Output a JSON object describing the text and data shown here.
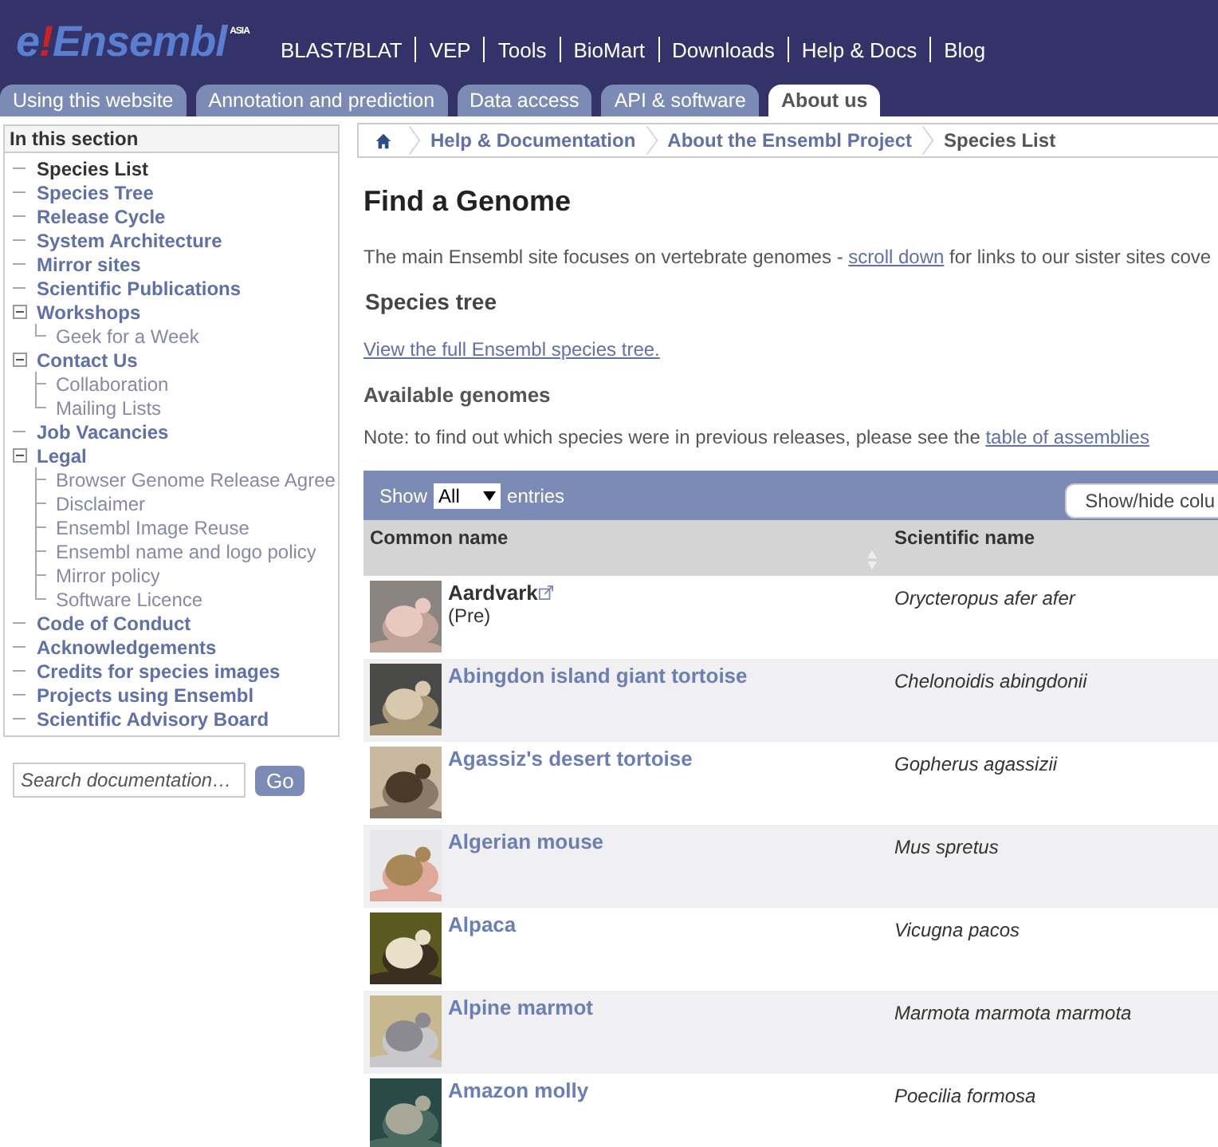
{
  "logo": {
    "parts": [
      "e",
      "!",
      "Ensembl"
    ],
    "badge": "ASIA"
  },
  "top_nav": [
    "BLAST/BLAT",
    "VEP",
    "Tools",
    "BioMart",
    "Downloads",
    "Help & Docs",
    "Blog"
  ],
  "tabs": [
    {
      "label": "Using this website",
      "selected": false
    },
    {
      "label": "Annotation and prediction",
      "selected": false
    },
    {
      "label": "Data access",
      "selected": false
    },
    {
      "label": "API & software",
      "selected": false
    },
    {
      "label": "About us",
      "selected": true
    }
  ],
  "sidebar": {
    "title": "In this section",
    "items": [
      {
        "label": "Species List",
        "selected": true
      },
      {
        "label": "Species Tree",
        "selected": false
      },
      {
        "label": "Release Cycle",
        "selected": false
      },
      {
        "label": "System Architecture",
        "selected": false
      },
      {
        "label": "Mirror sites",
        "selected": false
      },
      {
        "label": "Scientific Publications",
        "selected": false
      },
      {
        "label": "Workshops",
        "selected": false,
        "expanded": true,
        "children": [
          {
            "label": "Geek for a Week"
          }
        ]
      },
      {
        "label": "Contact Us",
        "selected": false,
        "expanded": true,
        "children": [
          {
            "label": "Collaboration"
          },
          {
            "label": "Mailing Lists"
          }
        ]
      },
      {
        "label": "Job Vacancies",
        "selected": false
      },
      {
        "label": "Legal",
        "selected": false,
        "expanded": true,
        "children": [
          {
            "label": "Browser Genome Release Agree"
          },
          {
            "label": "Disclaimer"
          },
          {
            "label": "Ensembl Image Reuse"
          },
          {
            "label": "Ensembl name and logo policy"
          },
          {
            "label": "Mirror policy"
          },
          {
            "label": "Software Licence"
          }
        ]
      },
      {
        "label": "Code of Conduct",
        "selected": false
      },
      {
        "label": "Acknowledgements",
        "selected": false
      },
      {
        "label": "Credits for species images",
        "selected": false
      },
      {
        "label": "Projects using Ensembl",
        "selected": false
      },
      {
        "label": "Scientific Advisory Board",
        "selected": false
      }
    ]
  },
  "search": {
    "placeholder": "Search documentation…",
    "button": "Go"
  },
  "breadcrumb": [
    "Help & Documentation",
    "About the Ensembl Project",
    "Species List"
  ],
  "title": "Find a Genome",
  "intro": {
    "before": "The main Ensembl site focuses on vertebrate genomes - ",
    "link": "scroll down",
    "after": " for links to our sister sites cove"
  },
  "species_tree": {
    "heading": "Species tree",
    "link": "View the full Ensembl species tree."
  },
  "available": {
    "heading": "Available genomes",
    "note": "Note: to find out which species were in previous releases, please see the ",
    "link": "table of assemblies"
  },
  "table": {
    "show_label": "Show",
    "show_value": "All",
    "entries_label": "entries",
    "columns_button": "Show/hide colu",
    "columns": [
      "Common name",
      "Scientific name"
    ],
    "rows": [
      {
        "kind": "pre",
        "common": "Aardvark",
        "note": "(Pre)",
        "scientific": "Orycteropus afer afer"
      },
      {
        "kind": "standard",
        "common": "Abingdon island giant tortoise",
        "scientific": "Chelonoidis abingdonii"
      },
      {
        "kind": "standard",
        "common": "Agassiz's desert tortoise",
        "scientific": "Gopherus agassizii"
      },
      {
        "kind": "standard",
        "common": "Algerian mouse",
        "scientific": "Mus spretus"
      },
      {
        "kind": "standard",
        "common": "Alpaca",
        "scientific": "Vicugna pacos"
      },
      {
        "kind": "standard",
        "common": "Alpine marmot",
        "scientific": "Marmota marmota marmota"
      },
      {
        "kind": "standard",
        "common": "Amazon molly",
        "scientific": "Poecilia formosa"
      }
    ]
  }
}
